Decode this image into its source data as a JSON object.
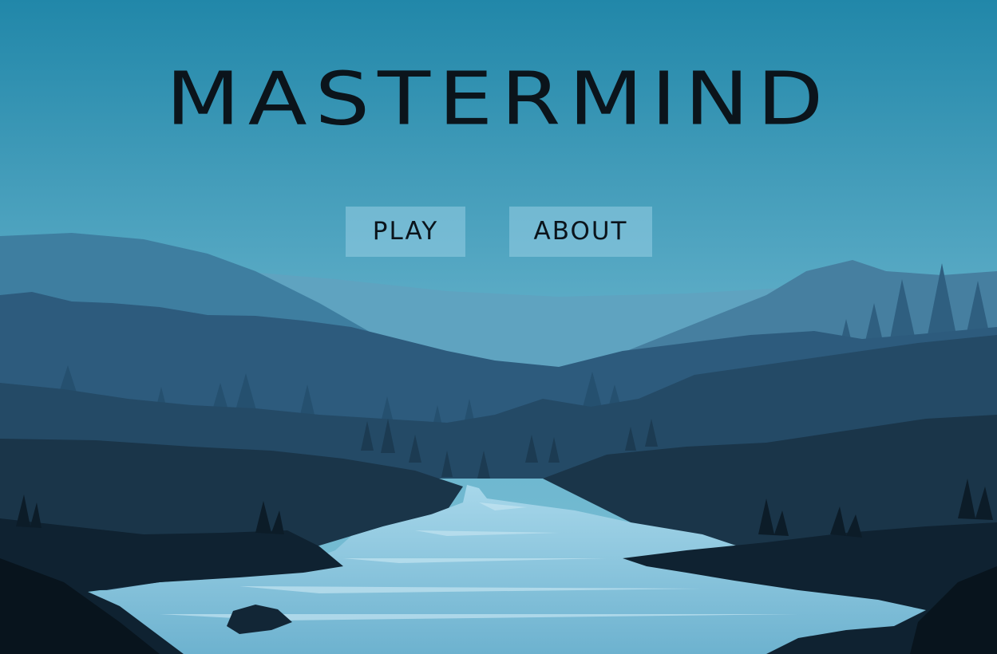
{
  "game": {
    "title": "MASTERMIND"
  },
  "menu": {
    "play_label": "PLAY",
    "about_label": "ABOUT"
  },
  "colors": {
    "sky_top": "#2187a9",
    "sky_bottom": "#6cb6cf",
    "title_text": "#0b141b",
    "button_bg": "#7fbfd9",
    "river": "#8cc6dd"
  }
}
